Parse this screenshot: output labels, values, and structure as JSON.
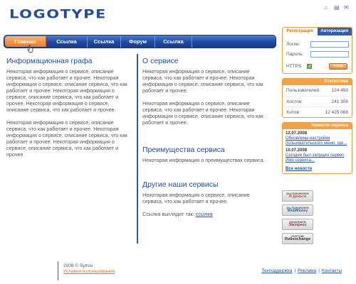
{
  "header": {
    "logo": "LOGOTYPE",
    "icons": [
      "home-icon",
      "map-icon",
      "mail-icon"
    ]
  },
  "nav": {
    "items": [
      "Главная",
      "Ссылка",
      "Ссылка",
      "Форум",
      "Ссылка"
    ]
  },
  "left": {
    "title": "Информационная графа",
    "paragraphs": [
      "Некоторая информация о сервисе, описание сервиса, что как работает и прочее. Некоторая информация о сервисе, описание сервиса, что как работает и прочее. Некоторая информация о сервисе, описание сервиса, что как работает и прочее. Некоторая информация о сервисе, описание сервиса, что как работает и прочее.",
      "Некоторая информация о сервисе, описание сервиса, что как работает и прочее. Некоторая информация о сервисе, описание сервиса, что как работает и прочее. Некоторая информация о сервисе, описание сервиса, что как работает и прочее."
    ]
  },
  "main": {
    "about": {
      "title": "О сервисе",
      "paragraphs": [
        "Некоторая информация о сервисе, описание сервиса, что как работает и прочее. Некоторая информация о сервисе, описание сервиса, что как работает и прочее.",
        "Некоторая информация о сервисе, описание сервиса, что как работает и прочее. Некоторая информация о сервисе, описание сервиса, что как работает и прочее."
      ]
    },
    "advantages": {
      "title": "Преимущества сервиса",
      "text": "Некоторая информация о преимуществах сервиса."
    },
    "other": {
      "title": "Другие наши сервисы",
      "text": "Некоторая информация о сервисе, описание сервиса, что как работает и прочее.",
      "link_prefix": "Ссылка выглядит так:",
      "link_text": "ссылка"
    }
  },
  "login": {
    "tab_register": "Регистрация",
    "tab_login": "Авторизация",
    "login_label": "Логин:",
    "password_label": "Пароль:",
    "https_label": "HTTPS",
    "https_checked": true,
    "submit_label": "вход"
  },
  "stats": {
    "title": "Статистика",
    "rows": [
      {
        "label": "Пользователей:",
        "value": "124 493"
      },
      {
        "label": "Хостов:",
        "value": "241 308"
      },
      {
        "label": "Хитов:",
        "value": "12 425 068"
      }
    ]
  },
  "news": {
    "title": "Новости сервиса",
    "items": [
      {
        "date": "12.07.2008",
        "text": "Обновлены настройки пользовательского меню, где..."
      },
      {
        "date": "10.07.2008",
        "text": "Сегодня был запущен сервис Имя сервиса..."
      }
    ],
    "all_label": "Все новости"
  },
  "badges": [
    {
      "top": "мы принимаем",
      "sub": "Я деньги"
    },
    {
      "top": "мы принимаем",
      "sub": "WebMoney"
    },
    {
      "top": "принимаем",
      "sub": "Экспресс"
    },
    {
      "top": "участник",
      "sub": "Roboxchange"
    }
  ],
  "footer": {
    "copyright": "2008 © Sytrus",
    "terms": "Условия использования",
    "links": [
      "Техподдержка",
      "Реклама",
      "Контакты"
    ],
    "separator": "|"
  },
  "colors": {
    "brand_blue": "#1e4fa6",
    "accent_orange": "#f49a3a"
  }
}
